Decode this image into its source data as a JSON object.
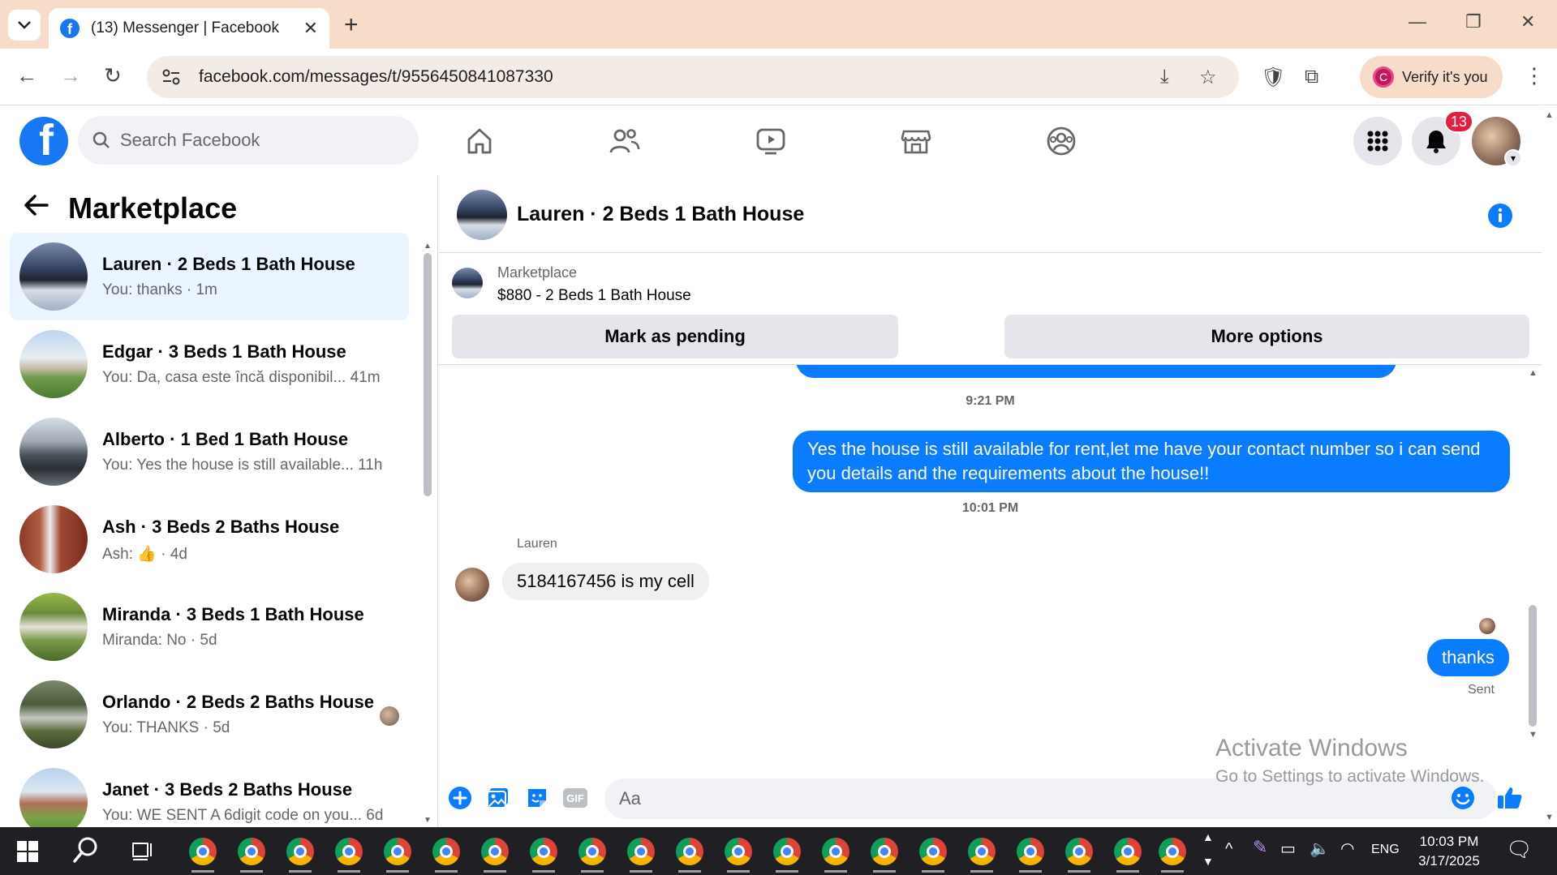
{
  "browser": {
    "tab_title": "(13) Messenger | Facebook",
    "url": "facebook.com/messages/t/9556450841087330",
    "verify_label": "Verify it's you",
    "verify_badge": "C"
  },
  "fb": {
    "logo": "f",
    "search_placeholder": "Search Facebook",
    "notification_count": "13",
    "nav_icons": [
      "home-icon",
      "friends-icon",
      "watch-icon",
      "marketplace-icon",
      "groups-icon"
    ]
  },
  "left": {
    "title": "Marketplace",
    "conversations": [
      {
        "name": "Lauren · 2 Beds 1 Bath House",
        "snippet": "You: thanks · 1m",
        "active": true
      },
      {
        "name": "Edgar · 3 Beds 1 Bath House",
        "snippet": "You: Da, casa este încă disponibil...   41m"
      },
      {
        "name": "Alberto · 1 Bed 1 Bath House",
        "snippet": "You: Yes the house is still available...  11h"
      },
      {
        "name": "Ash · 3 Beds 2 Baths House",
        "snippet_prefix": "Ash: ",
        "snippet_suffix": " · 4d"
      },
      {
        "name": "Miranda · 3 Beds 1 Bath House",
        "snippet": "Miranda: No · 5d"
      },
      {
        "name": "Orlando · 2 Beds 2 Baths House",
        "snippet": "You: THANKS · 5d"
      },
      {
        "name": "Janet · 3 Beds 2 Baths House",
        "snippet": "You: WE SENT A 6digit code on you...   6d"
      }
    ]
  },
  "chat": {
    "title": "Lauren · 2 Beds 1 Bath House",
    "listing_source": "Marketplace",
    "listing_price": "$880 - 2 Beds 1 Bath House",
    "btn_pending": "Mark as pending",
    "btn_more": "More options",
    "time1": "9:21 PM",
    "msg_out_1": "Yes the house is still available for rent,let me have your contact number so i can send you details and the requirements about the house!!",
    "time2": "10:01 PM",
    "sender_name": "Lauren",
    "msg_in_1": "5184167456 is my cell",
    "msg_out_2": "thanks",
    "sent_status": "Sent",
    "composer_placeholder": "Aa"
  },
  "watermark": {
    "line1": "Activate Windows",
    "line2": "Go to Settings to activate Windows."
  },
  "taskbar": {
    "language": "ENG",
    "time": "10:03 PM",
    "date": "3/17/2025"
  },
  "colors": {
    "fb_blue": "#1877f2",
    "messenger_blue": "#0a7cff",
    "active_conv": "#ebf5ff"
  }
}
